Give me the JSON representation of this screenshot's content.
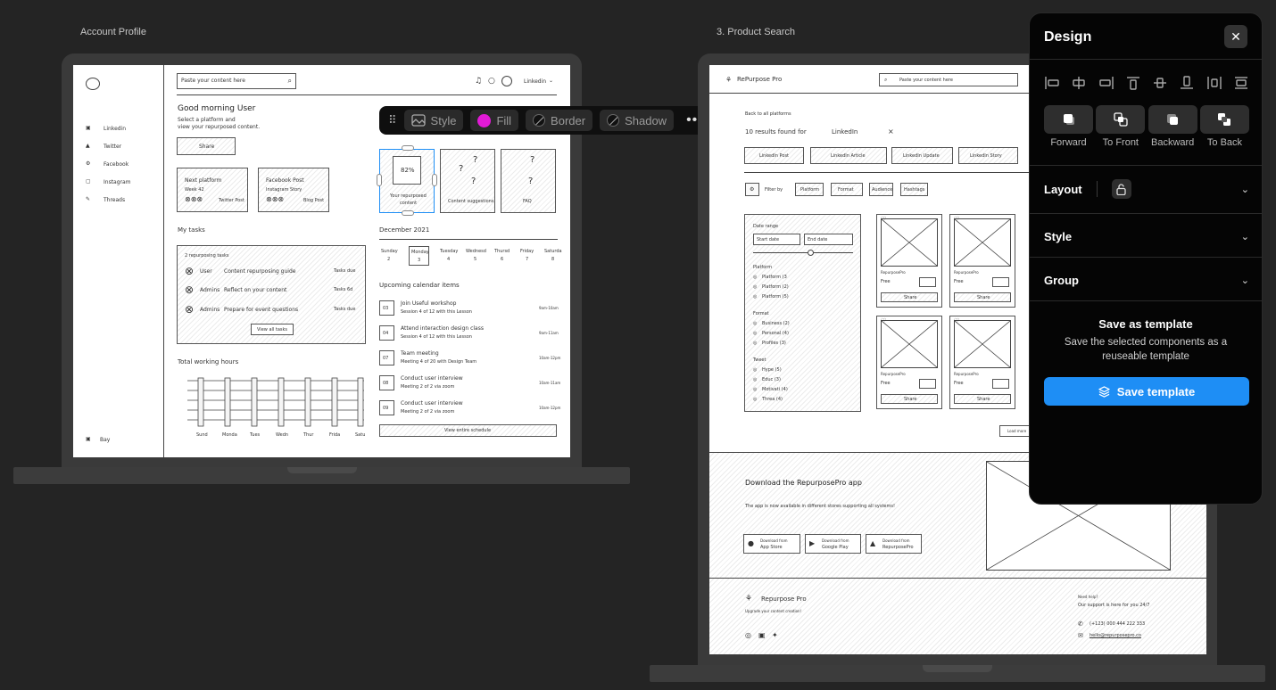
{
  "frames": {
    "left_label": "Account Profile",
    "right_label": "3. Product Search"
  },
  "account": {
    "search_placeholder": "Paste your content here",
    "user_menu": "Linkedin",
    "sidebar": [
      "Linkedin",
      "Twitter",
      "Facebook",
      "Instagram",
      "Threads"
    ],
    "sidebar_footer": "Bay",
    "greeting": "Good morning User",
    "sub1": "Select a platform and",
    "sub2": "view your repurposed content.",
    "share": "Share",
    "card1_title": "Next platform",
    "card1_sub": "Week 42",
    "card1_tag": "Twitter Post",
    "card2_title": "Facebook Post",
    "card2_sub": "Instagram Story",
    "card2_tag": "Blog Post",
    "stat_percent": "82%",
    "stat_label1": "Your repurposed",
    "stat_label2": "content",
    "stat2": "Content suggestions",
    "stat3": "FAQ",
    "tasks_title": "My tasks",
    "tasks_sub": "2 repurposing tasks",
    "tasks": [
      {
        "who": "User",
        "what": "Content repurposing guide",
        "due": "Tasks due"
      },
      {
        "who": "Admins",
        "what": "Reflect on your content",
        "due": "Tasks 6d"
      },
      {
        "who": "Admins",
        "what": "Prepare for event questions",
        "due": "Tasks due"
      }
    ],
    "view_tasks": "View all tasks",
    "hours_title": "Total working hours",
    "days": [
      "Sund",
      "Monda",
      "Tues",
      "Wedn",
      "Thur",
      "Frida",
      "Satu"
    ],
    "calendar_title": "December 2021",
    "week": [
      {
        "d": "Sunday",
        "n": "2"
      },
      {
        "d": "Monday",
        "n": "3"
      },
      {
        "d": "Tuesday",
        "n": "4"
      },
      {
        "d": "Wednesd",
        "n": "5"
      },
      {
        "d": "Thursd",
        "n": "6"
      },
      {
        "d": "Friday",
        "n": "7"
      },
      {
        "d": "Saturda",
        "n": "8"
      }
    ],
    "upcoming_title": "Upcoming calendar items",
    "events": [
      {
        "n": "03",
        "t": "Join Useful workshop",
        "s": "Session 4 of 12 with this Lesson",
        "time": "9am-10am"
      },
      {
        "n": "04",
        "t": "Attend interaction design class",
        "s": "Session 4 of 12 with this Lesson",
        "time": "9am-11am"
      },
      {
        "n": "07",
        "t": "Team meeting",
        "s": "Meeting 4 of 20 with Design Team",
        "time": "10am-12pm"
      },
      {
        "n": "08",
        "t": "Conduct user interview",
        "s": "Meeting 2 of 2 via zoom",
        "time": "10am-11am"
      },
      {
        "n": "09",
        "t": "Conduct user interview",
        "s": "Meeting 2 of 2 via zoom",
        "time": "10am-12pm"
      }
    ],
    "view_schedule": "View entire schedule"
  },
  "toolbar": {
    "style": "Style",
    "fill": "Fill",
    "border": "Border",
    "shadow": "Shadow",
    "fill_color": "#e21ad6"
  },
  "search": {
    "brand": "RePurpose Pro",
    "search_placeholder": "Paste your content here",
    "back": "Back to all platforms",
    "results": "10 results found for",
    "query": "LinkedIn",
    "chips": [
      "LinkedIn Post",
      "LinkedIn Article",
      "LinkedIn Update",
      "LinkedIn Story"
    ],
    "filter_label": "Filter by",
    "filters": [
      "Platform",
      "Format",
      "Audience",
      "Hashtags"
    ],
    "date_range": "Date range",
    "start_date": "Start date",
    "end_date": "End date",
    "platform_head": "Platform",
    "platform_opts": [
      "Platform (3",
      "Platform (2)",
      "Platform (5)"
    ],
    "format_head": "Format",
    "format_opts": [
      "Business (2)",
      "Personal (4)",
      "Profiles (3)"
    ],
    "tweet_head": "Tweet",
    "tweet_opts": [
      "Hype (5)",
      "Educ (3)",
      "Motivati (4)",
      "Threa (4)"
    ],
    "product_name": "RepurposePro",
    "product_price": "Free",
    "product_share": "Share",
    "load_more": "Load more",
    "download_title": "Download the RepurposePro app",
    "download_sub": "The app is now available in different stores supporting all systems!",
    "stores": [
      {
        "top": "Download from",
        "name": "App Store"
      },
      {
        "top": "Download from",
        "name": "Google Play"
      },
      {
        "top": "Download from",
        "name": "RepurposePro"
      }
    ],
    "footer_brand": "Repurpose Pro",
    "footer_tag": "Upgrade your content creation!",
    "need_help": "Need help?",
    "support": "Our support is here for you 24/7",
    "phone": "(+123) 000 444 222 333",
    "email": "hello@repurposepro.co"
  },
  "panel": {
    "title": "Design",
    "order": [
      "Forward",
      "To Front",
      "Backward",
      "To Back"
    ],
    "layout": "Layout",
    "style": "Style",
    "group": "Group",
    "template_title": "Save as template",
    "template_desc": "Save the selected components as a reuseable template",
    "save_button": "Save template",
    "accent": "#1e8ef5"
  }
}
